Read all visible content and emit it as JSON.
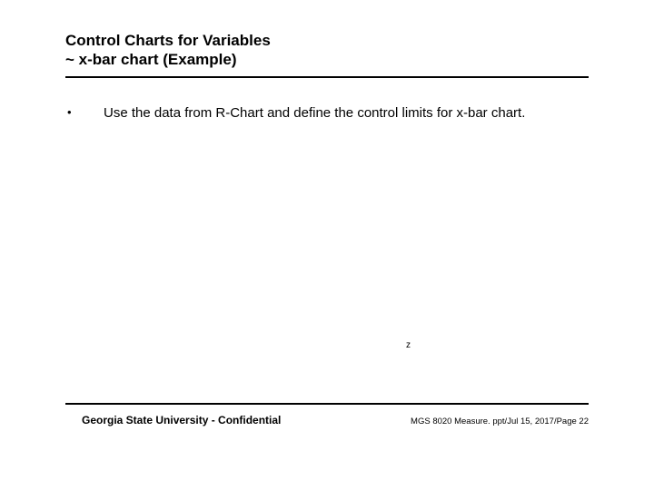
{
  "header": {
    "title_line1": "Control Charts for Variables",
    "title_line2": "~ x-bar chart (Example)"
  },
  "body": {
    "bullet_marker": "•",
    "bullet_text": "Use the data from R-Chart and define the control limits for x-bar chart."
  },
  "marks": {
    "z": "z"
  },
  "footer": {
    "left": "Georgia State University - Confidential",
    "right_file": "MGS 8020 Measure. ppt/",
    "right_date": "Jul 15, 2017/",
    "right_page": "Page 22"
  }
}
